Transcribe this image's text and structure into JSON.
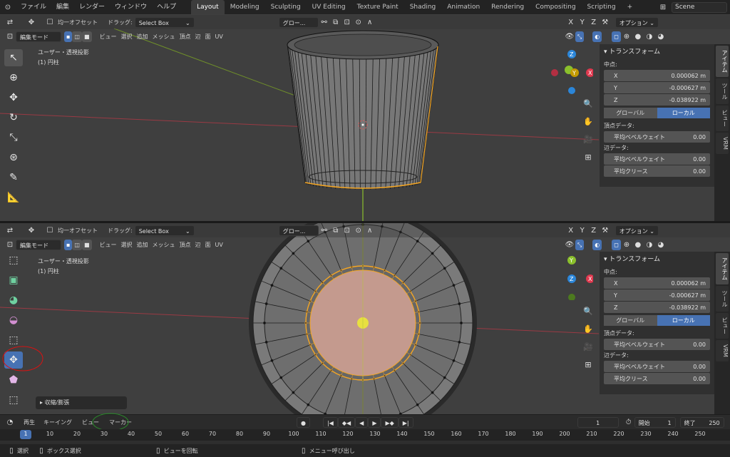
{
  "topbar": {
    "menus": [
      "ファイル",
      "編集",
      "レンダー",
      "ウィンドウ",
      "ヘルプ"
    ],
    "workspaces": [
      "Layout",
      "Modeling",
      "Sculpting",
      "UV Editing",
      "Texture Paint",
      "Shading",
      "Animation",
      "Rendering",
      "Compositing",
      "Scripting"
    ],
    "active_workspace": "Layout",
    "add_tab": "+",
    "scene_name": "Scene"
  },
  "viewport_top": {
    "header1": {
      "uniform_offset": "均一オフセット",
      "drag_label": "ドラッグ:",
      "drag_value": "Select Box",
      "transform_orientation": "グロー...",
      "options": "オプション"
    },
    "header2": {
      "mode": "編集モード",
      "menus": [
        "ビュー",
        "選択",
        "追加",
        "メッシュ",
        "頂点",
        "辺",
        "面",
        "UV"
      ]
    },
    "overlay_line1": "ユーザー・透視投影",
    "overlay_line2": "(1) 円柱",
    "gizmo": {
      "x": "X",
      "y": "Y",
      "z": "Z"
    }
  },
  "viewport_bottom": {
    "header1": {
      "uniform_offset": "均一オフセット",
      "drag_label": "ドラッグ:",
      "drag_value": "Select Box",
      "transform_orientation": "グロー...",
      "options": "オプション"
    },
    "header2": {
      "mode": "編集モード",
      "menus": [
        "ビュー",
        "選択",
        "追加",
        "メッシュ",
        "頂点",
        "辺",
        "面",
        "UV"
      ]
    },
    "overlay_line1": "ユーザー・透視投影",
    "overlay_line2": "(1) 円柱",
    "operator_panel": "収縮/膨張",
    "gizmo": {
      "x": "X",
      "y": "Y",
      "z": "Z"
    }
  },
  "sidebar": {
    "title": "トランスフォーム",
    "median_label": "中点:",
    "x_label": "X",
    "x_value": "0.000062 m",
    "y_label": "Y",
    "y_value": "-0.000627 m",
    "z_label": "Z",
    "z_value": "-0.038922 m",
    "global_btn": "グローバル",
    "local_btn": "ローカル",
    "vertex_data": "頂点データ:",
    "vertex_bevel_label": "平均ベベルウェイト",
    "vertex_bevel_value": "0.00",
    "edge_data": "辺データ:",
    "edge_bevel_label": "平均ベベルウェイト",
    "edge_bevel_value": "0.00",
    "edge_crease_label": "平均クリース",
    "edge_crease_value": "0.00",
    "tabs": [
      "アイテム",
      "ツール",
      "ビュー",
      "VRM"
    ]
  },
  "timeline": {
    "playback": "再生",
    "keying": "キーイング",
    "view": "ビュー",
    "marker": "マーカー",
    "current_frame": "1",
    "start_label": "開始",
    "start_value": "1",
    "end_label": "終了",
    "end_value": "250",
    "ruler": [
      "1",
      "10",
      "20",
      "30",
      "40",
      "50",
      "60",
      "70",
      "80",
      "90",
      "100",
      "110",
      "120",
      "130",
      "140",
      "150",
      "160",
      "170",
      "180",
      "190",
      "200",
      "210",
      "220",
      "230",
      "240",
      "250"
    ]
  },
  "statusbar": {
    "select": "選択",
    "box_select": "ボックス選択",
    "rotate_view": "ビューを回転",
    "call_menu": "メニュー呼び出し"
  },
  "colors": {
    "accent": "#4772b3",
    "selected_edge": "#f5a623",
    "axis_x": "#e0394f",
    "axis_y": "#8bc02c",
    "axis_z": "#2b86d9"
  }
}
